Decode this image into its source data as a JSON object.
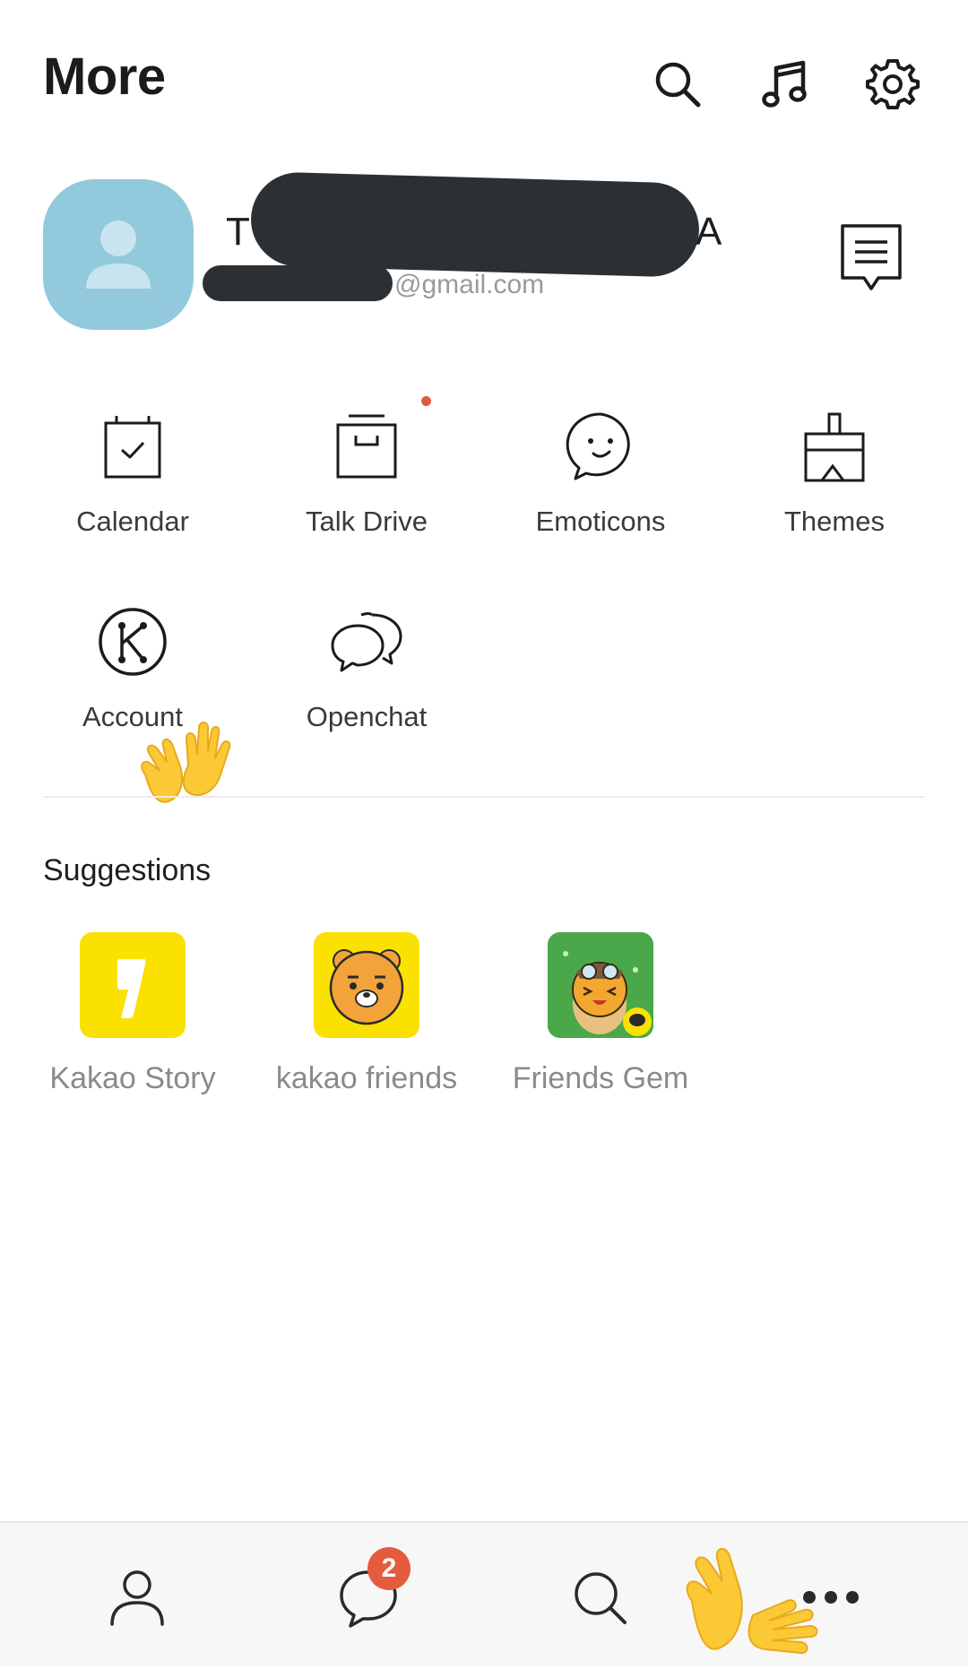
{
  "header": {
    "title": "More"
  },
  "profile": {
    "name_start": "T",
    "name_end": "A",
    "email_domain": "@gmail.com"
  },
  "grid": [
    {
      "label": "Calendar"
    },
    {
      "label": "Talk Drive"
    },
    {
      "label": "Emoticons"
    },
    {
      "label": "Themes"
    },
    {
      "label": "Account"
    },
    {
      "label": "Openchat"
    }
  ],
  "suggestions": {
    "title": "Suggestions",
    "items": [
      {
        "label": "Kakao Story"
      },
      {
        "label": "kakao friends"
      },
      {
        "label": "Friends Gem"
      }
    ]
  },
  "bottom_nav": {
    "chats_badge": "2"
  },
  "colors": {
    "accent_yellow": "#FAE100",
    "badge_red": "#E55B3E",
    "avatar_blue": "#92C9DC"
  }
}
